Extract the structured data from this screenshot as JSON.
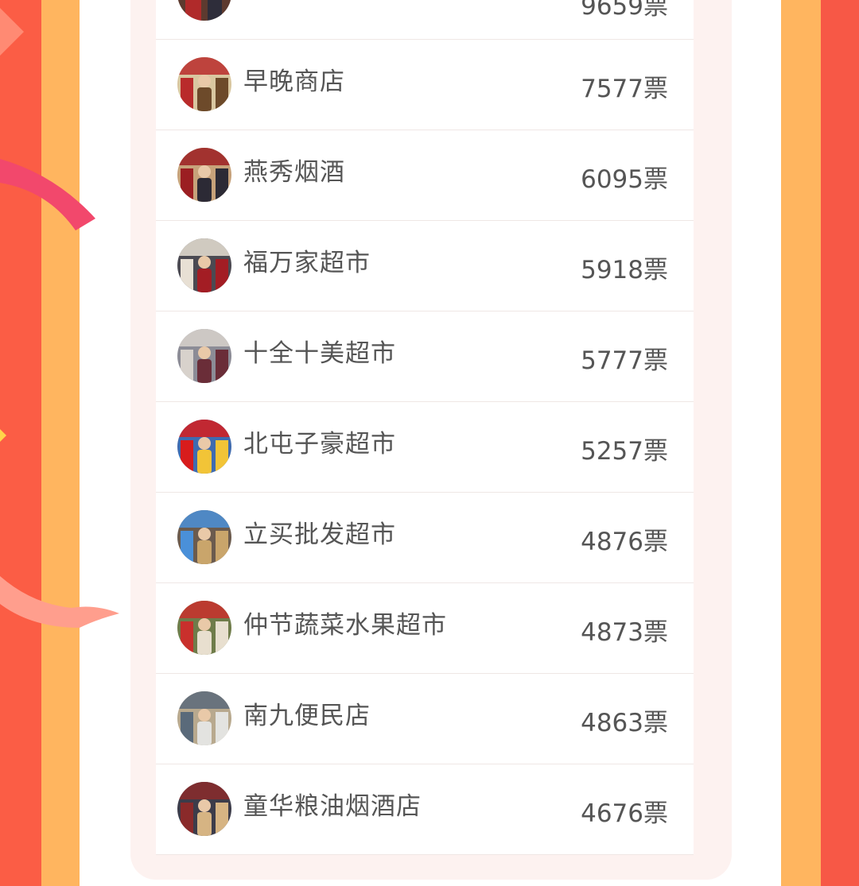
{
  "colors": {
    "outer_red": "#fb5d45",
    "outer_orange": "#ffb55f",
    "panel_bg": "#fdf2f0",
    "row_bg": "#ffffff",
    "text": "#555555"
  },
  "ranking": {
    "partial_top_votes": "9659票",
    "rows": [
      {
        "name": "早晚商店",
        "votes": "7577票",
        "avatar_colors": [
          "#b92b2b",
          "#6d4a2a",
          "#d9c7a0"
        ]
      },
      {
        "name": "燕秀烟酒",
        "votes": "6095票",
        "avatar_colors": [
          "#9b1e22",
          "#2c2a35",
          "#c7a27a"
        ]
      },
      {
        "name": "福万家超市",
        "votes": "5918票",
        "avatar_colors": [
          "#e8e0d4",
          "#a31d24",
          "#4b4a52"
        ]
      },
      {
        "name": "十全十美超市",
        "votes": "5777票",
        "avatar_colors": [
          "#d8d2cc",
          "#6a2d38",
          "#8c8c96"
        ]
      },
      {
        "name": "北屯子豪超市",
        "votes": "5257票",
        "avatar_colors": [
          "#d81c1c",
          "#f2c437",
          "#3f6bb0"
        ]
      },
      {
        "name": "立买批发超市",
        "votes": "4876票",
        "avatar_colors": [
          "#4a90d9",
          "#c9a56b",
          "#6b5b4e"
        ]
      },
      {
        "name": "仲节蔬菜水果超市",
        "votes": "4873票",
        "avatar_colors": [
          "#c9302c",
          "#e8dfcf",
          "#6f7c4a"
        ]
      },
      {
        "name": "南九便民店",
        "votes": "4863票",
        "avatar_colors": [
          "#5a6a7a",
          "#e3e3e0",
          "#b8a98e"
        ]
      },
      {
        "name": "童华粮油烟酒店",
        "votes": "4676票",
        "avatar_colors": [
          "#8a2a2a",
          "#d6b483",
          "#3c3c4a"
        ]
      }
    ]
  }
}
